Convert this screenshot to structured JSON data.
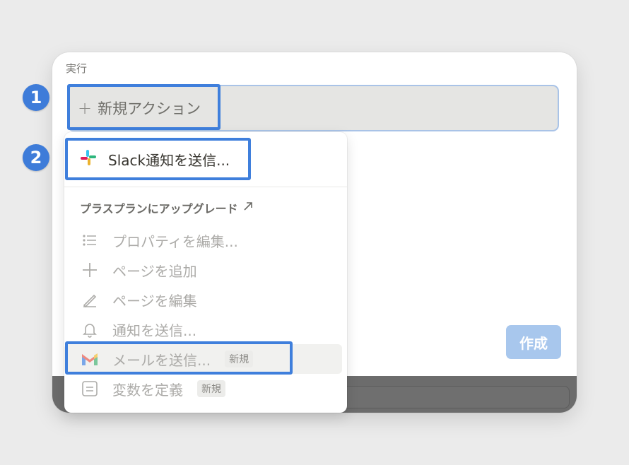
{
  "step_badges": [
    "1",
    "2"
  ],
  "section_label": "実行",
  "new_action": {
    "icon": "plus-icon",
    "label": "新規アクション"
  },
  "create_button": "作成",
  "menu": {
    "slack_item": {
      "icon": "slack-icon",
      "label": "Slack通知を送信..."
    },
    "upgrade": {
      "label": "プラスプランにアップグレード",
      "icon": "arrow-up-right-icon"
    },
    "items": [
      {
        "icon": "list-icon",
        "label": "プロパティを編集..."
      },
      {
        "icon": "plus-icon",
        "label": "ページを追加"
      },
      {
        "icon": "pencil-icon",
        "label": "ページを編集"
      },
      {
        "icon": "bell-icon",
        "label": "通知を送信..."
      },
      {
        "icon": "gmail-icon",
        "label": "メールを送信...",
        "tag": "新規"
      },
      {
        "icon": "variable-icon",
        "label": "変数を定義",
        "tag": "新規"
      }
    ]
  },
  "colors": {
    "highlight": "#3f7fdc",
    "badge": "#3e7cd9",
    "create_button_bg": "#a8c7ed",
    "disabled_text": "#acaba8"
  }
}
